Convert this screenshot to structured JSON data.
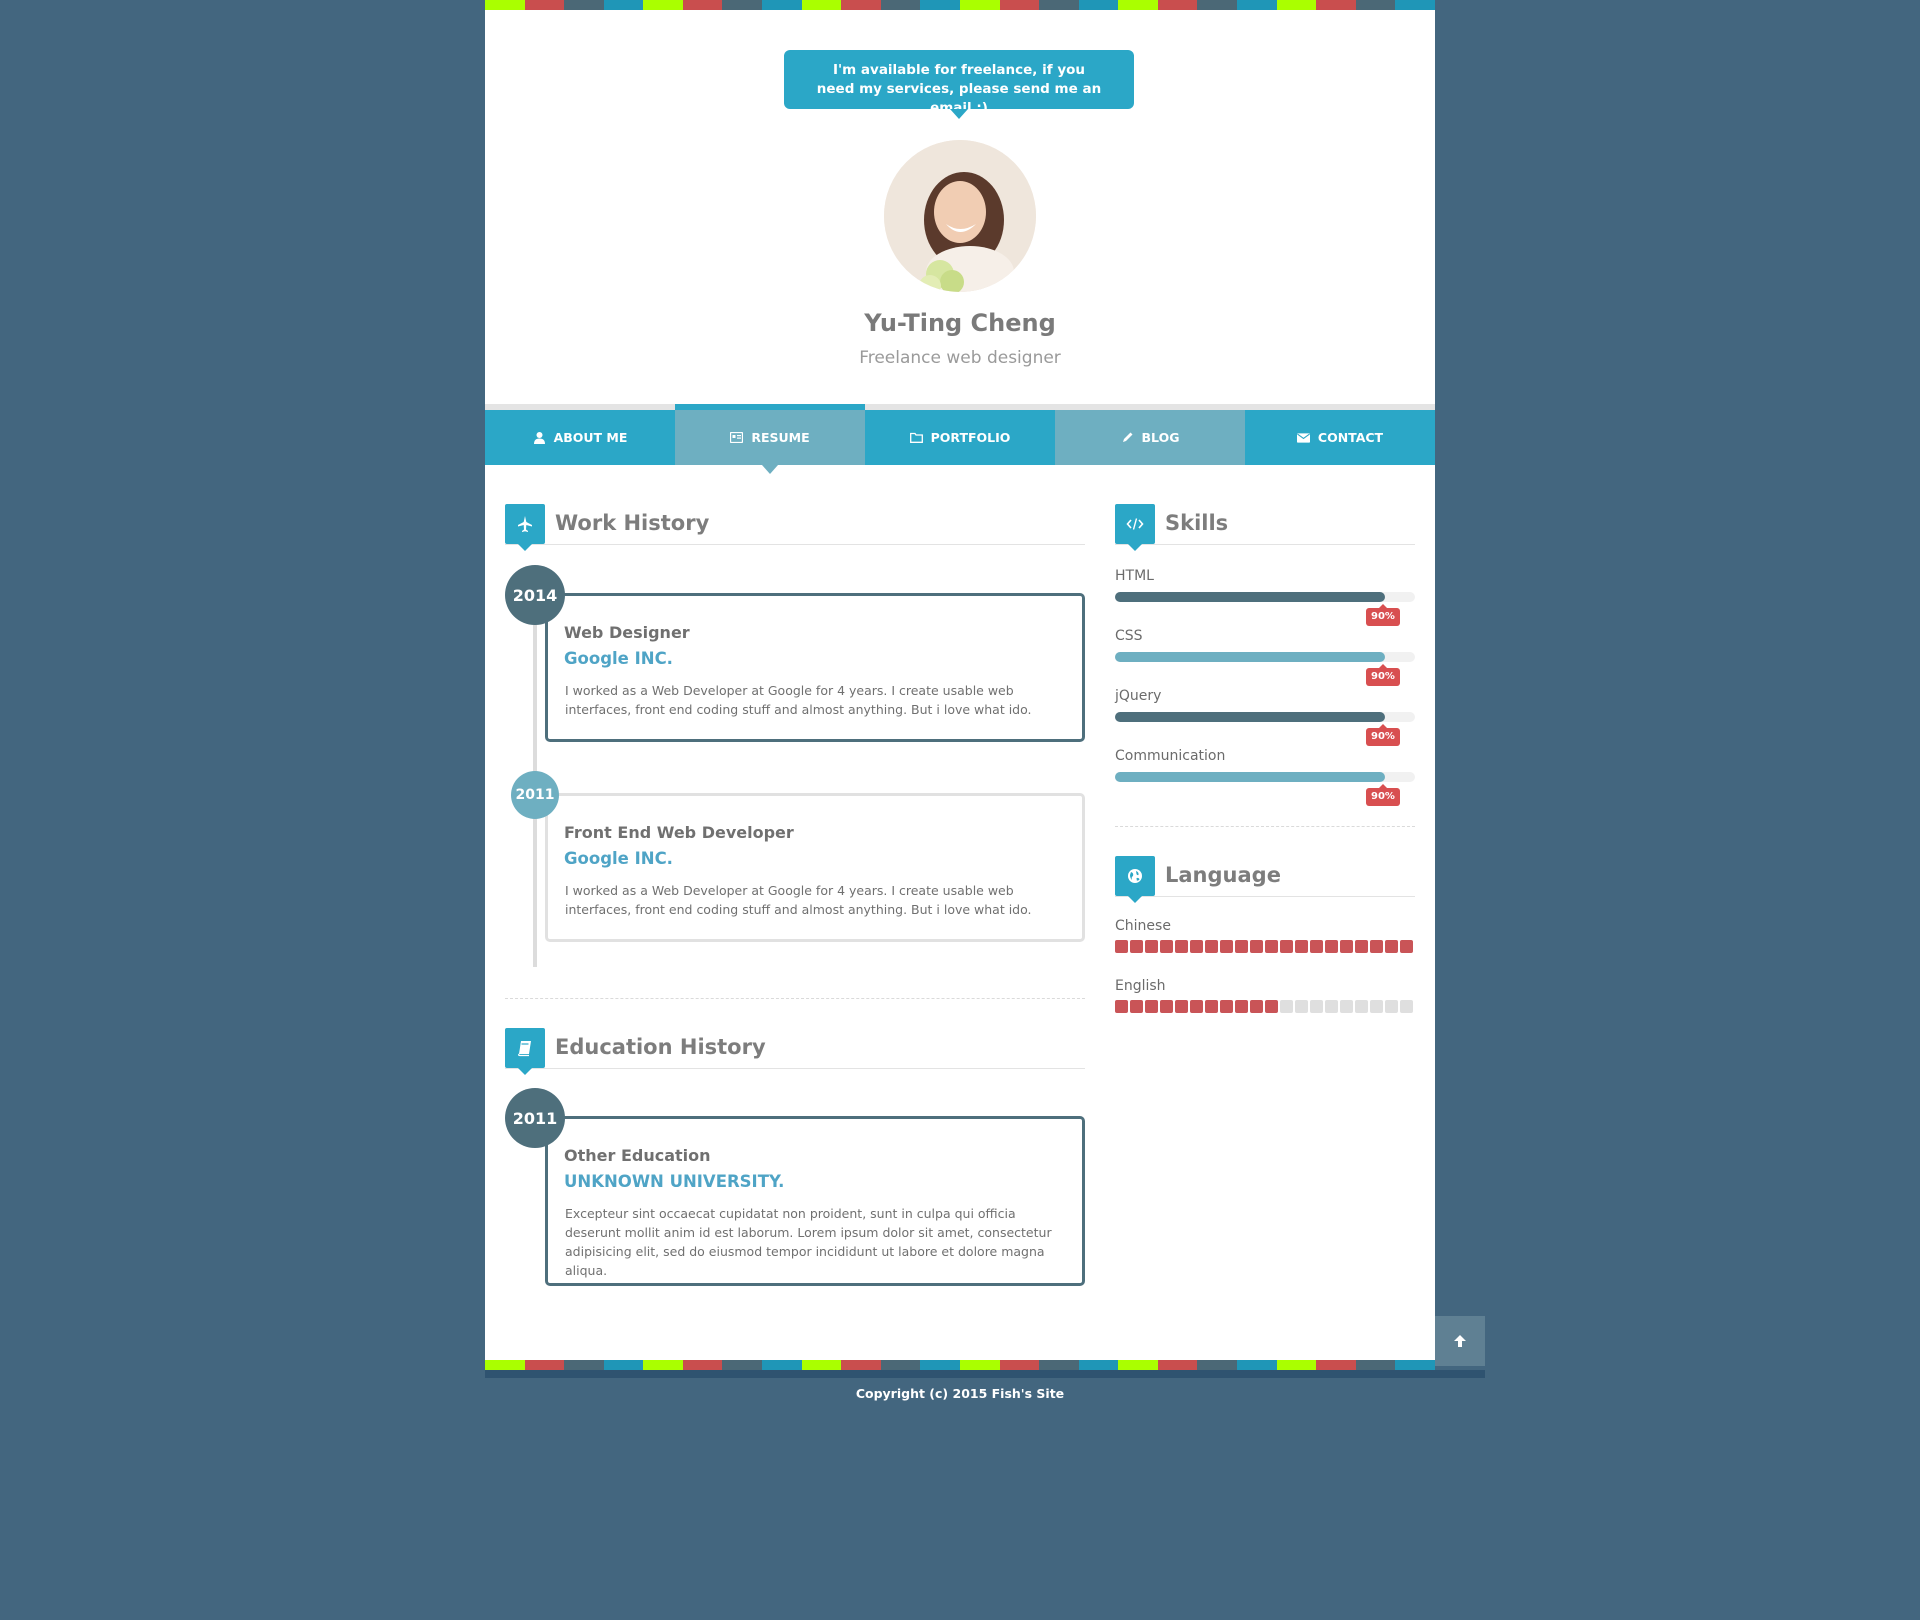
{
  "colors": {
    "background": "#43667f",
    "accent": "#2ba7c7",
    "nav_light": "#6eafc1",
    "dark_slate": "#4e6f7c",
    "red": "#d84f50",
    "lime": "#aaff00",
    "teal": "#1f96b7",
    "grey_slate": "#4b6876"
  },
  "stripe_colors": [
    "#aaff00",
    "#c94e4e",
    "#4b6876",
    "#1f96b7"
  ],
  "freelance_bubble": "I'm available for freelance, if you need my services, please send me an email :)",
  "profile": {
    "name": "Yu-Ting Cheng",
    "role": "Freelance web designer"
  },
  "nav": [
    {
      "label": "About Me",
      "icon": "user-icon"
    },
    {
      "label": "Resume",
      "icon": "resume-icon",
      "active": true
    },
    {
      "label": "Portfolio",
      "icon": "folder-icon"
    },
    {
      "label": "Blog",
      "icon": "pencil-icon"
    },
    {
      "label": "Contact",
      "icon": "envelope-icon"
    }
  ],
  "work": {
    "title": "Work History",
    "icon": "airplane-icon",
    "items": [
      {
        "year": "2014",
        "title": "Web Designer",
        "company": "Google INC.",
        "description": "I worked as a Web Developer at Google for 4 years. I create usable web interfaces, front end coding stuff and almost anything. But i love what ido."
      },
      {
        "year": "2011",
        "title": "Front End Web Developer",
        "company": "Google INC.",
        "description": "I worked as a Web Developer at Google for 4 years. I create usable web interfaces, front end coding stuff and almost anything. But i love what ido."
      }
    ]
  },
  "education": {
    "title": "Education History",
    "icon": "book-icon",
    "items": [
      {
        "year": "2011",
        "title": "Other Education",
        "company": "UNKNOWN UNIVERSITY.",
        "description": "Excepteur sint occaecat cupidatat non proident, sunt in culpa qui officia deserunt mollit anim id est laborum. Lorem ipsum dolor sit amet, consectetur adipisicing elit, sed do eiusmod tempor incididunt ut labore et dolore magna aliqua."
      }
    ]
  },
  "skills": {
    "title": "Skills",
    "icon": "code-icon",
    "items": [
      {
        "name": "HTML",
        "percent": "90%",
        "level": 0.9,
        "color": "#4e6f7c"
      },
      {
        "name": "CSS",
        "percent": "90%",
        "level": 0.9,
        "color": "#6eafc1"
      },
      {
        "name": "jQuery",
        "percent": "90%",
        "level": 0.9,
        "color": "#4e6f7c"
      },
      {
        "name": "Communication",
        "percent": "90%",
        "level": 0.9,
        "color": "#6eafc1"
      }
    ]
  },
  "language": {
    "title": "Language",
    "icon": "globe-icon",
    "items": [
      {
        "name": "Chinese",
        "filled": 20,
        "total": 20
      },
      {
        "name": "English",
        "filled": 11,
        "total": 20
      }
    ]
  },
  "footer": {
    "copyright": "Copyright (c) 2015 Fish's Site",
    "to_top_icon": "arrow-up-icon"
  }
}
